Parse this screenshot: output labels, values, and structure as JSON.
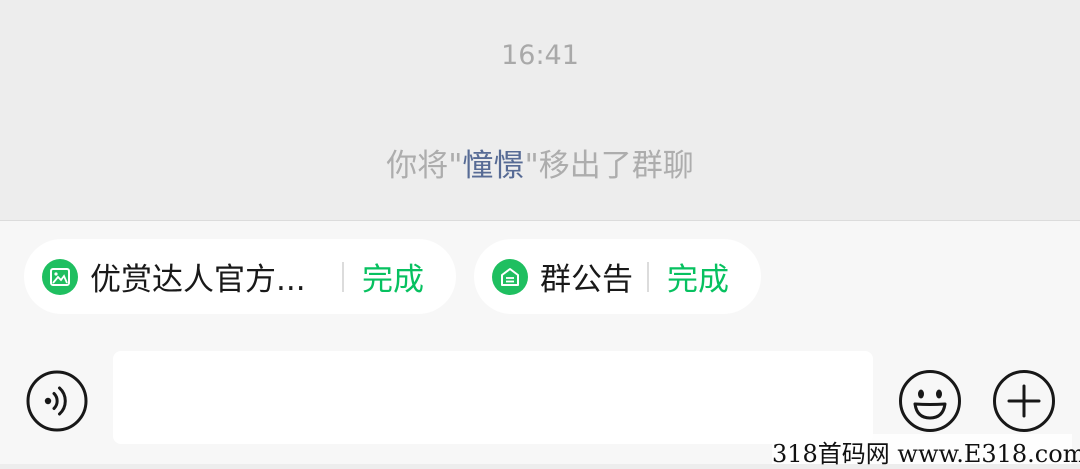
{
  "chat": {
    "timestamp": "16:41",
    "system_message": {
      "prefix": "你将\"",
      "name": "憧憬",
      "suffix": "\"移出了群聊"
    }
  },
  "chips": [
    {
      "title": "优赏达人官方...",
      "action": "完成",
      "icon": "mini-program-image-icon"
    },
    {
      "title": "群公告",
      "action": "完成",
      "icon": "announcement-icon"
    }
  ],
  "input": {
    "value": "",
    "placeholder": ""
  },
  "watermark": "318首码网 www.E318.com",
  "colors": {
    "accent": "#07c160",
    "link": "#576b95",
    "chat_bg": "#ededed",
    "panel_bg": "#f7f7f7"
  }
}
